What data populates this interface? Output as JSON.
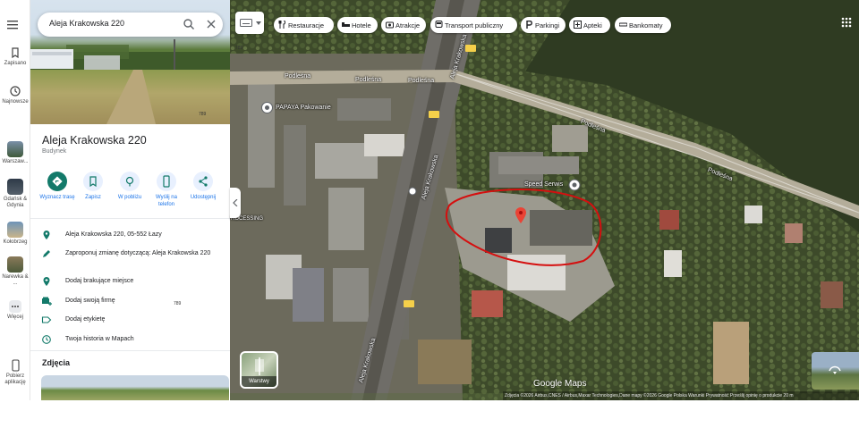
{
  "rail": {
    "menu_icon": "hamburger-menu-icon",
    "items": [
      {
        "label": "Zapisano",
        "icon": "bookmark-icon"
      },
      {
        "label": "Najnowsze",
        "icon": "history-icon"
      },
      {
        "label": "Warszaw...",
        "icon": "recent-place-thumb"
      },
      {
        "label": "Gdańsk & Gdynia",
        "icon": "recent-place-thumb"
      },
      {
        "label": "Kołobrzeg",
        "icon": "recent-place-thumb"
      },
      {
        "label": "Narewka & ...",
        "icon": "recent-place-thumb"
      },
      {
        "label": "Więcej",
        "icon": "more-icon"
      },
      {
        "label": "Pobierz aplikację",
        "icon": "phone-icon"
      }
    ]
  },
  "search": {
    "value": "Aleja Krakowska 220"
  },
  "place": {
    "title": "Aleja Krakowska 220",
    "category": "Budynek",
    "actions": [
      {
        "label": "Wyznacz trasę",
        "icon": "directions-icon"
      },
      {
        "label": "Zapisz",
        "icon": "bookmark-icon"
      },
      {
        "label": "W pobliżu",
        "icon": "nearby-icon"
      },
      {
        "label": "Wyślij na telefon",
        "icon": "send-to-phone-icon"
      },
      {
        "label": "Udostępnij",
        "icon": "share-icon"
      }
    ],
    "info": [
      {
        "text": "Aleja Krakowska 220, 05-552 Łazy",
        "icon": "location-pin-icon"
      },
      {
        "text": "Zaproponuj zmianę dotyczącą: Aleja Krakowska 220",
        "icon": "edit-pencil-icon"
      },
      {
        "text": "Dodaj brakujące miejsce",
        "icon": "add-place-icon"
      },
      {
        "text": "Dodaj swoją firmę",
        "icon": "add-business-icon"
      },
      {
        "text": "Dodaj etykietę",
        "icon": "label-icon"
      },
      {
        "text": "Twoja historia w Mapach",
        "icon": "history-icon"
      }
    ],
    "photos_title": "Zdjęcia"
  },
  "chips": [
    {
      "label": "Restauracje",
      "icon": "restaurant-icon"
    },
    {
      "label": "Hotele",
      "icon": "hotel-icon"
    },
    {
      "label": "Atrakcje",
      "icon": "camera-icon"
    },
    {
      "label": "Transport publiczny",
      "icon": "transit-icon"
    },
    {
      "label": "Parkingi",
      "icon": "parking-icon"
    },
    {
      "label": "Apteki",
      "icon": "pharmacy-icon"
    },
    {
      "label": "Bankomaty",
      "icon": "atm-icon"
    }
  ],
  "map": {
    "labels": {
      "podlesna_1": "Podleśna",
      "podlesna_2": "Podleśna",
      "podlesna_3": "Podleśna",
      "podlesna_4": "Podleśna",
      "podlesna_5": "Podleśna",
      "aleja_1": "Aleja Krakowska",
      "aleja_2": "Aleja Krakowska",
      "aleja_3": "Aleja Krakowska",
      "papaya": "PAPAYA Pakowanie",
      "speed": "Speed Serwis",
      "processing": "ROCESSING",
      "route_1": "789",
      "route_2": "789",
      "route_3": "789"
    },
    "layers_label": "Warstwy",
    "logo": "Google Maps",
    "attribution": "Zdjęcia ©2026 Airbus,CNES / Airbus,Maxar Technologies,Dane mapy ©2026 Google   Polska   Warunki   Prywatność   Prześlij opinię o produkcie   20 m",
    "colors": {
      "highlight": "#d50f0f",
      "pin": "#ea4335",
      "accent": "#1a73e8",
      "teal": "#137a6a"
    }
  }
}
